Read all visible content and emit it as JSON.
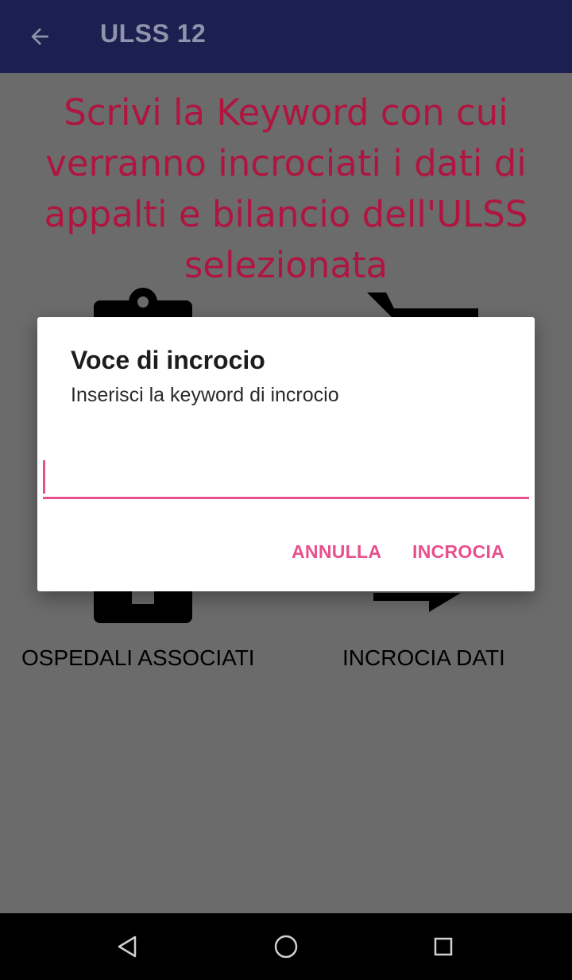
{
  "appbar": {
    "title": "ULSS 12",
    "back_icon": "arrow-back-icon"
  },
  "main": {
    "headline": "Scrivi la Keyword con cui verranno incrociati i dati di appalti e bilancio dell'ULSS selezionata",
    "grid": [
      {
        "label": "OSPEDALI ASSOCIATI",
        "icon": "clipboard-icon"
      },
      {
        "label": "INCROCIA DATI",
        "icon": "shopping-cart-icon"
      }
    ]
  },
  "dialog": {
    "title": "Voce di incrocio",
    "message": "Inserisci la keyword di incrocio",
    "input_value": "",
    "cancel_label": "ANNULLA",
    "ok_label": "INCROCIA"
  },
  "colors": {
    "accent": "#e8508c",
    "headline": "#b0153f",
    "appbar": "#1b2050",
    "scrim_background": "#6b6b6b"
  },
  "navbar": {
    "back_icon": "nav-back-icon",
    "home_icon": "nav-home-icon",
    "recent_icon": "nav-recents-icon"
  }
}
